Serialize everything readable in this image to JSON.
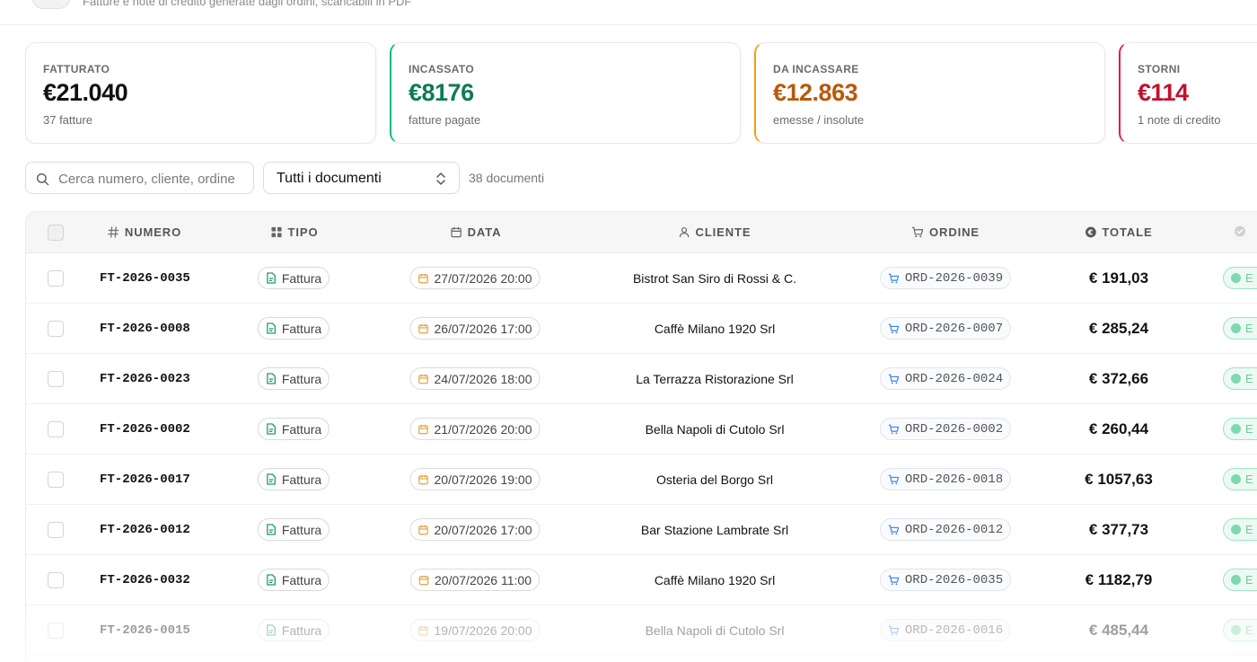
{
  "header": {
    "subtitle": "Fatture e note di credito generate dagli ordini, scaricabili in PDF"
  },
  "stats": [
    {
      "label": "FATTURATO",
      "value": "€21.040",
      "sub": "37 fatture",
      "color": "#111111"
    },
    {
      "label": "INCASSATO",
      "value": "€8176",
      "sub": "fatture pagate",
      "color": "#0f7a55"
    },
    {
      "label": "DA INCASSARE",
      "value": "€12.863",
      "sub": "emesse / insolute",
      "color": "#b85a0a"
    },
    {
      "label": "STORNI",
      "value": "€114",
      "sub": "1 note di credito",
      "color": "#c0122f"
    }
  ],
  "toolbar": {
    "search_placeholder": "Cerca numero, cliente, ordine",
    "filter_value": "Tutti i documenti",
    "count": "38 documenti"
  },
  "table": {
    "headers": {
      "numero": "NUMERO",
      "tipo": "TIPO",
      "data": "DATA",
      "cliente": "CLIENTE",
      "ordine": "ORDINE",
      "totale": "TOTALE"
    },
    "rows": [
      {
        "numero": "FT-2026-0035",
        "tipo": "Fattura",
        "data": "27/07/2026 20:00",
        "cliente": "Bistrot San Siro di Rossi & C.",
        "ordine": "ORD-2026-0039",
        "totale": "€ 191,03",
        "stato": "E"
      },
      {
        "numero": "FT-2026-0008",
        "tipo": "Fattura",
        "data": "26/07/2026 17:00",
        "cliente": "Caffè Milano 1920 Srl",
        "ordine": "ORD-2026-0007",
        "totale": "€ 285,24",
        "stato": "E"
      },
      {
        "numero": "FT-2026-0023",
        "tipo": "Fattura",
        "data": "24/07/2026 18:00",
        "cliente": "La Terrazza Ristorazione Srl",
        "ordine": "ORD-2026-0024",
        "totale": "€ 372,66",
        "stato": "E"
      },
      {
        "numero": "FT-2026-0002",
        "tipo": "Fattura",
        "data": "21/07/2026 20:00",
        "cliente": "Bella Napoli di Cutolo Srl",
        "ordine": "ORD-2026-0002",
        "totale": "€ 260,44",
        "stato": "E"
      },
      {
        "numero": "FT-2026-0017",
        "tipo": "Fattura",
        "data": "20/07/2026 19:00",
        "cliente": "Osteria del Borgo Srl",
        "ordine": "ORD-2026-0018",
        "totale": "€ 1057,63",
        "stato": "E"
      },
      {
        "numero": "FT-2026-0012",
        "tipo": "Fattura",
        "data": "20/07/2026 17:00",
        "cliente": "Bar Stazione Lambrate Srl",
        "ordine": "ORD-2026-0012",
        "totale": "€ 377,73",
        "stato": "E"
      },
      {
        "numero": "FT-2026-0032",
        "tipo": "Fattura",
        "data": "20/07/2026 11:00",
        "cliente": "Caffè Milano 1920 Srl",
        "ordine": "ORD-2026-0035",
        "totale": "€ 1182,79",
        "stato": "E"
      },
      {
        "numero": "FT-2026-0015",
        "tipo": "Fattura",
        "data": "19/07/2026 20:00",
        "cliente": "Bella Napoli di Cutolo Srl",
        "ordine": "ORD-2026-0016",
        "totale": "€ 485,44",
        "stato": "E"
      }
    ]
  }
}
